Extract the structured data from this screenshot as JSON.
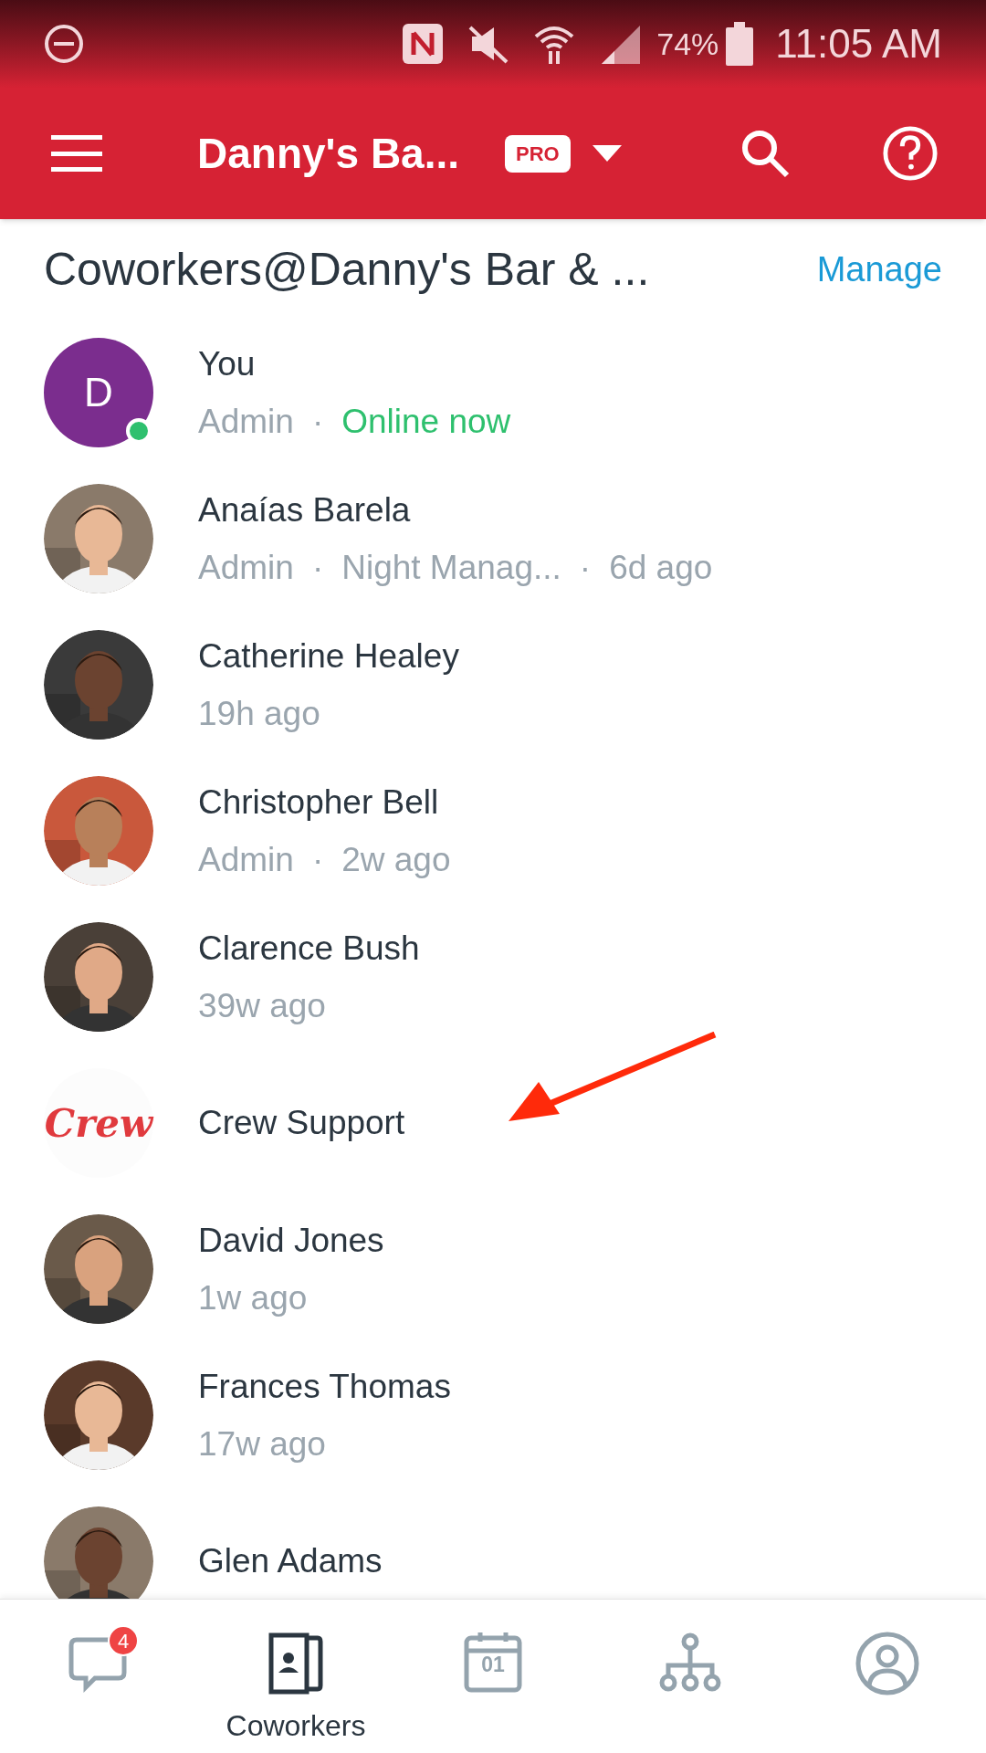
{
  "status_bar": {
    "battery": "74%",
    "time": "11:05 AM"
  },
  "app_bar": {
    "title": "Danny's Ba...",
    "badge": "PRO"
  },
  "section": {
    "title": "Coworkers@Danny's Bar & ...",
    "action": "Manage"
  },
  "members": [
    {
      "name": "You",
      "avatar": {
        "kind": "initial",
        "letter": "D",
        "color": "#7b2d8e",
        "online": true
      },
      "details": [
        {
          "text": "Admin",
          "kind": "plain"
        },
        {
          "text": "·",
          "kind": "separator"
        },
        {
          "text": "Online now",
          "kind": "online"
        }
      ]
    },
    {
      "name": "Anaías Barela",
      "details": [
        {
          "text": "Admin",
          "kind": "plain"
        },
        {
          "text": "·",
          "kind": "separator"
        },
        {
          "text": "Night Manag...",
          "kind": "plain"
        },
        {
          "text": "·",
          "kind": "separator"
        },
        {
          "text": "6d ago",
          "kind": "plain"
        }
      ]
    },
    {
      "name": "Catherine Healey",
      "details": [
        {
          "text": "19h ago",
          "kind": "plain"
        }
      ]
    },
    {
      "name": "Christopher Bell",
      "details": [
        {
          "text": "Admin",
          "kind": "plain"
        },
        {
          "text": "·",
          "kind": "separator"
        },
        {
          "text": "2w ago",
          "kind": "plain"
        }
      ]
    },
    {
      "name": "Clarence Bush",
      "details": [
        {
          "text": "39w ago",
          "kind": "plain"
        }
      ]
    },
    {
      "name": "Crew Support",
      "avatar": {
        "kind": "logo",
        "text": "Crew"
      }
    },
    {
      "name": "David Jones",
      "details": [
        {
          "text": "1w ago",
          "kind": "plain"
        }
      ]
    },
    {
      "name": "Frances Thomas",
      "details": [
        {
          "text": "17w ago",
          "kind": "plain"
        }
      ]
    },
    {
      "name": "Glen Adams"
    }
  ],
  "nav": [
    {
      "badge": "4",
      "selected": false
    },
    {
      "label": "Coworkers",
      "selected": true
    },
    {
      "text": "01",
      "selected": false
    },
    {
      "selected": false
    },
    {
      "selected": false
    }
  ]
}
